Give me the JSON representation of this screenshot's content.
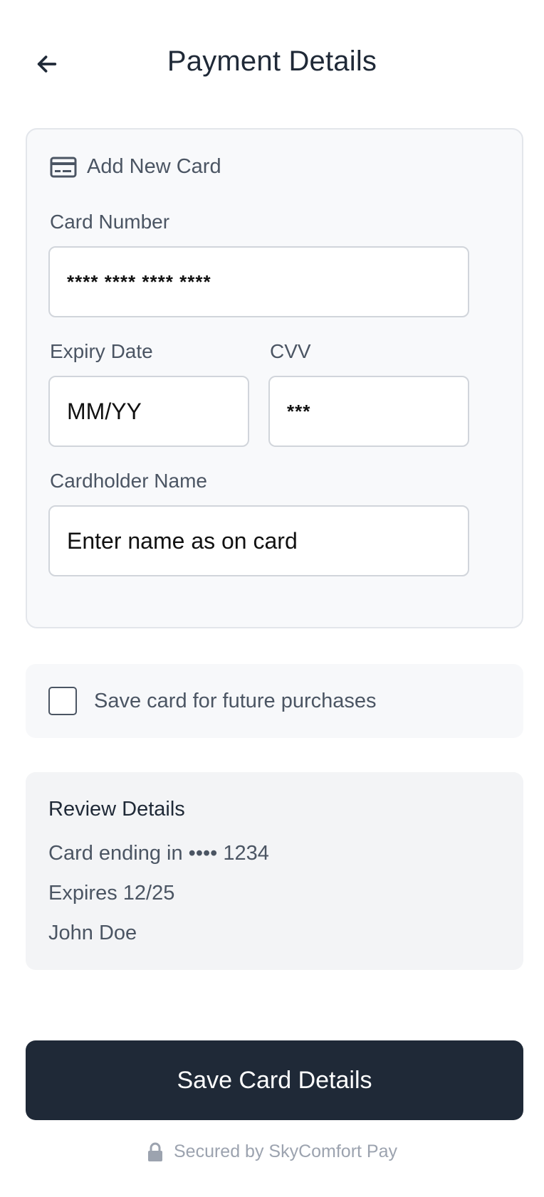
{
  "header": {
    "title": "Payment Details",
    "back_icon": "arrow-left-icon"
  },
  "card_form": {
    "section_title": "Add New Card",
    "section_icon": "credit-card-icon",
    "card_number": {
      "label": "Card Number",
      "placeholder": "**** **** **** ****"
    },
    "expiry": {
      "label": "Expiry Date",
      "placeholder": "MM/YY"
    },
    "cvv": {
      "label": "CVV",
      "placeholder": "***"
    },
    "cardholder": {
      "label": "Cardholder Name",
      "placeholder": "Enter name as on card"
    }
  },
  "save_option": {
    "label": "Save card for future purchases",
    "checked": false
  },
  "review": {
    "title": "Review Details",
    "card_line": "Card ending in •••• 1234",
    "expiry_line": "Expires 12/25",
    "name_line": "John Doe"
  },
  "actions": {
    "save_label": "Save Card Details"
  },
  "footer": {
    "secured_text": "Secured by SkyComfort Pay",
    "lock_icon": "lock-icon"
  },
  "colors": {
    "primary_button": "#1f2937",
    "panel_bg": "#f8f9fb",
    "review_bg": "#f3f4f6",
    "muted_text": "#9ca3af"
  }
}
